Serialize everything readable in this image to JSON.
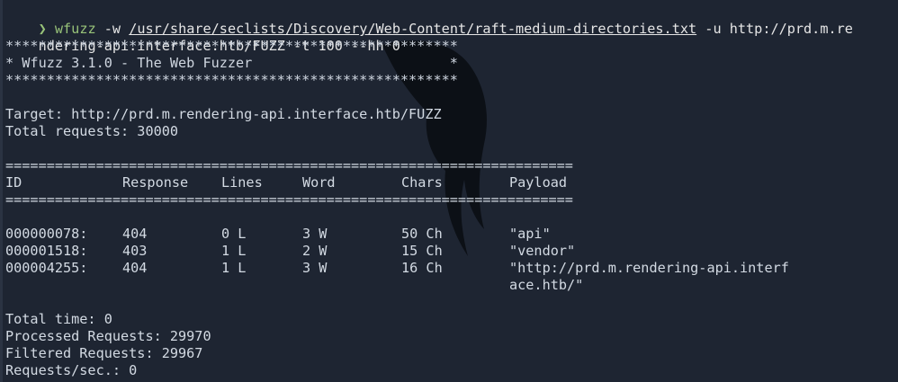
{
  "command": {
    "prompt_symbol": "❯",
    "program": "wfuzz",
    "flag_w": "-w",
    "wordlist_path": "/usr/share/seclists/Discovery/Web-Content/raft-medium-directories.txt",
    "flag_u": "-u",
    "url_part1": "http://prd.m.re",
    "url_part2": "ndering-api.interface.htb/FUZZ -t 100 --hh 0"
  },
  "banner": {
    "stars": "*******************************************************",
    "title_line": "* Wfuzz 3.1.0 - The Web Fuzzer                        *"
  },
  "target_line": "Target: http://prd.m.rendering-api.interface.htb/FUZZ",
  "total_requests_line": "Total requests: 30000",
  "separator": "=====================================================================",
  "table": {
    "headers": {
      "id": "ID",
      "response": "Response",
      "lines": "Lines",
      "word": "Word",
      "chars": "Chars",
      "payload": "Payload"
    },
    "rows": [
      {
        "id": "000000078:",
        "response": "404",
        "lines": "0 L",
        "word": "3 W",
        "chars": "50 Ch",
        "payload": "\"api\""
      },
      {
        "id": "000001518:",
        "response": "403",
        "lines": "1 L",
        "word": "2 W",
        "chars": "15 Ch",
        "payload": "\"vendor\""
      },
      {
        "id": "000004255:",
        "response": "404",
        "lines": "1 L",
        "word": "3 W",
        "chars": "16 Ch",
        "payload": "\"http://prd.m.rendering-api.interf",
        "payload_cont": "ace.htb/\""
      }
    ]
  },
  "summary": {
    "total_time": "Total time: 0",
    "processed": "Processed Requests: 29970",
    "filtered": "Filtered Requests: 29967",
    "rate": "Requests/sec.: 0"
  },
  "colors": {
    "background": "#1e2532",
    "text": "#d3dae3",
    "prompt": "#98c379"
  }
}
